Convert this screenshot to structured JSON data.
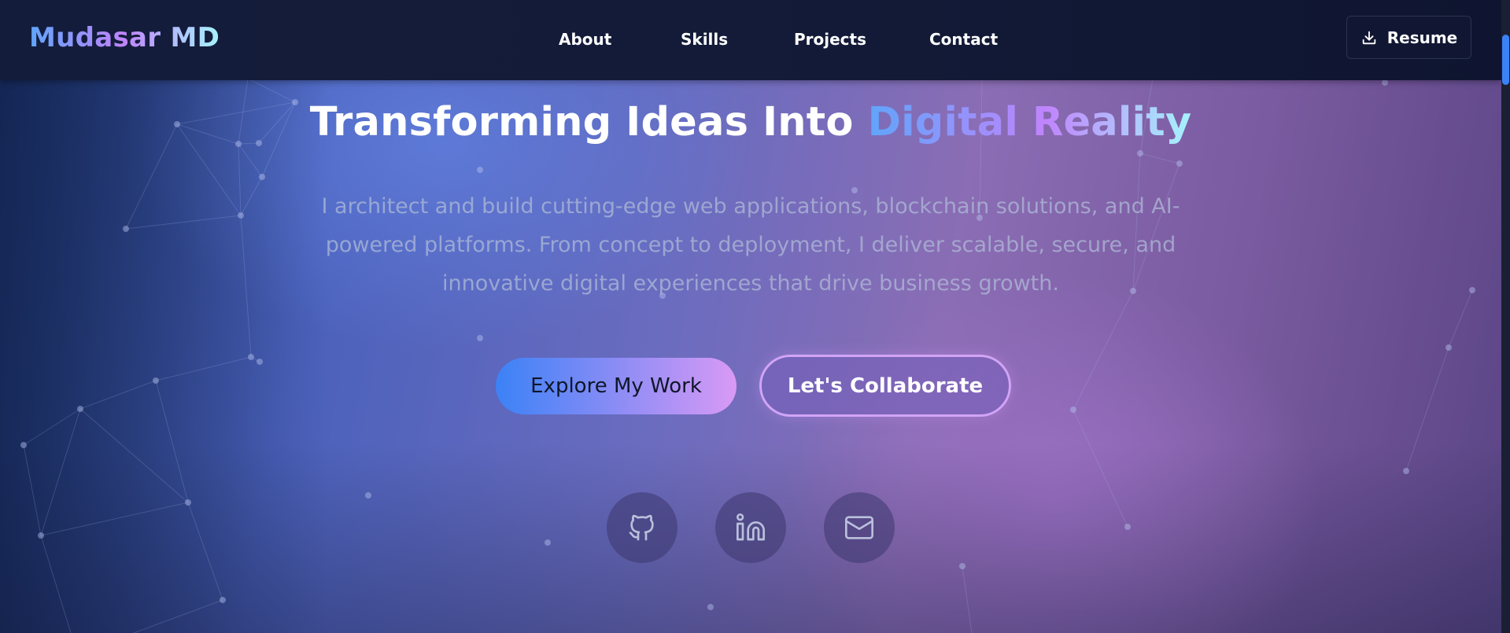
{
  "nav": {
    "logo": "Mudasar MD",
    "links": [
      {
        "label": "About"
      },
      {
        "label": "Skills"
      },
      {
        "label": "Projects"
      },
      {
        "label": "Contact"
      }
    ],
    "resume_label": "Resume"
  },
  "hero": {
    "headline_plain": "Transforming Ideas Into ",
    "headline_gradient": "Digital Reality",
    "subtitle": "I architect and build cutting-edge web applications, blockchain solutions, and AI-powered platforms. From concept to deployment, I deliver scalable, secure, and innovative digital experiences that drive business growth.",
    "primary_cta": "Explore My Work",
    "secondary_cta": "Let's Collaborate"
  },
  "social": [
    {
      "icon": "github-icon"
    },
    {
      "icon": "linkedin-icon"
    },
    {
      "icon": "mail-icon"
    }
  ],
  "colors": {
    "accent_blue": "#3b82f6",
    "accent_purple": "#c084fc",
    "accent_cyan": "#a5f3fc",
    "nav_bg": "#131b38"
  }
}
